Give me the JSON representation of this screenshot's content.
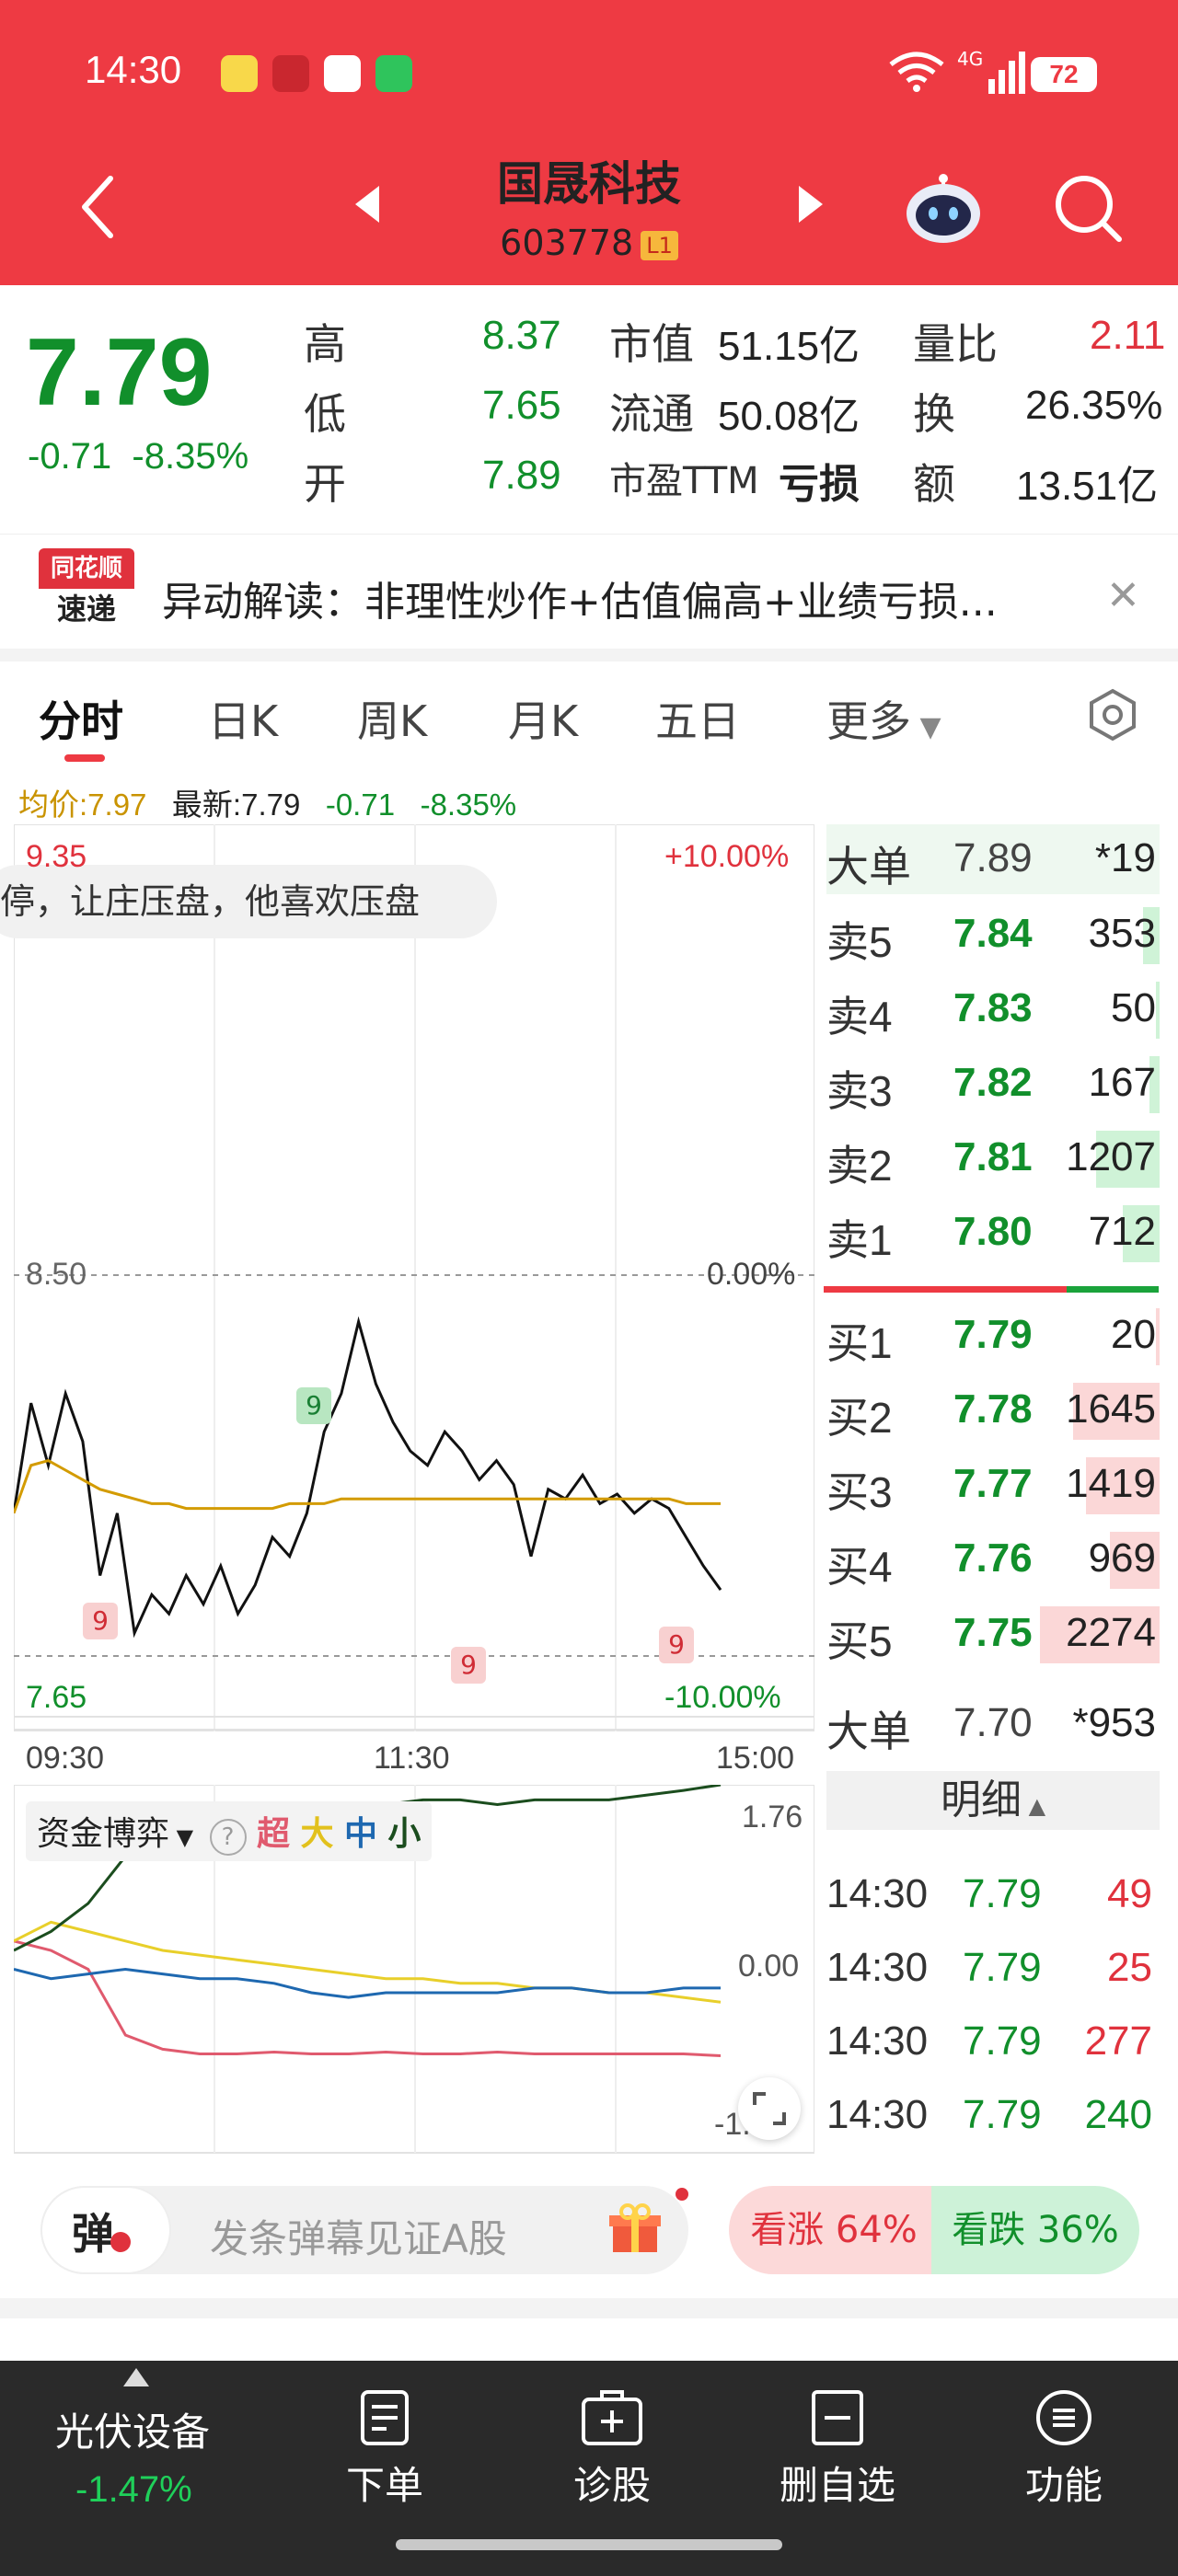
{
  "status_bar": {
    "time": "14:30",
    "network": "4G",
    "battery": "72"
  },
  "header": {
    "stock_name": "国晟科技",
    "stock_code": "603778",
    "level": "L1"
  },
  "quote": {
    "price": "7.79",
    "change": "-0.71",
    "change_pct": "-8.35%",
    "high_label": "高",
    "high": "8.37",
    "low_label": "低",
    "low": "7.65",
    "open_label": "开",
    "open": "7.89",
    "mktcap_label": "市值",
    "mktcap": "51.15亿",
    "float_label": "流通",
    "float": "50.08亿",
    "pe_label": "市盈TTM",
    "pe": "亏损",
    "volratio_label": "量比",
    "volratio": "2.11",
    "turnover_label": "换",
    "turnover": "26.35%",
    "amount_label": "额",
    "amount": "13.51亿"
  },
  "alert": {
    "logo_line1": "同花顺",
    "logo_line2": "速递",
    "text": "异动解读：非理性炒作+估值偏高+业绩亏损..."
  },
  "tabs": [
    "分时",
    "日K",
    "周K",
    "月K",
    "五日",
    "更多"
  ],
  "chart_header": {
    "avg": "均价:7.97",
    "latest": "最新:7.79",
    "chg": "-0.71",
    "pct": "-8.35%"
  },
  "chart_labels": {
    "top_price": "9.35",
    "top_pct": "+10.00%",
    "mid_price": "8.50",
    "mid_pct": "0.00%",
    "bot_price": "7.65",
    "bot_pct": "-10.00%",
    "t_start": "09:30",
    "t_mid": "11:30",
    "t_end": "15:00",
    "bubble": "停，让庄压盘，他喜欢压盘",
    "marker": "9"
  },
  "chart_data": [
    {
      "type": "line",
      "title": "",
      "x_range": [
        "09:30",
        "15:00"
      ],
      "ylim": [
        7.65,
        9.35
      ],
      "prev_close": 8.5,
      "series": [
        {
          "name": "最新",
          "values": [
            7.95,
            8.18,
            8.05,
            8.2,
            8.1,
            7.82,
            7.95,
            7.7,
            7.78,
            7.74,
            7.82,
            7.76,
            7.84,
            7.74,
            7.8,
            7.9,
            7.86,
            7.95,
            8.12,
            8.2,
            8.35,
            8.22,
            8.14,
            8.08,
            8.05,
            8.12,
            8.08,
            8.02,
            8.06,
            8.01,
            7.86,
            8.0,
            7.98,
            8.03,
            7.97,
            7.99,
            7.95,
            7.98,
            7.96,
            7.9,
            7.84,
            7.79
          ]
        },
        {
          "name": "均价",
          "values": [
            7.95,
            8.05,
            8.06,
            8.04,
            8.02,
            8.0,
            7.99,
            7.98,
            7.97,
            7.97,
            7.96,
            7.96,
            7.96,
            7.96,
            7.96,
            7.96,
            7.97,
            7.97,
            7.97,
            7.98,
            7.98,
            7.98,
            7.98,
            7.98,
            7.98,
            7.98,
            7.98,
            7.98,
            7.98,
            7.98,
            7.98,
            7.98,
            7.98,
            7.98,
            7.98,
            7.98,
            7.98,
            7.98,
            7.98,
            7.97,
            7.97,
            7.97
          ]
        }
      ]
    },
    {
      "type": "line",
      "title": "资金博弈",
      "ylim": [
        -1.76,
        1.76
      ],
      "series": [
        {
          "name": "超",
          "values": [
            0.1,
            0.0,
            -0.2,
            -0.9,
            -1.05,
            -1.1,
            -1.1,
            -1.08,
            -1.1,
            -1.1,
            -1.08,
            -1.1,
            -1.1,
            -1.08,
            -1.1,
            -1.1,
            -1.1,
            -1.1,
            -1.1,
            -1.12
          ]
        },
        {
          "name": "大",
          "values": [
            0.1,
            0.3,
            0.2,
            0.1,
            0.0,
            -0.05,
            -0.1,
            -0.15,
            -0.2,
            -0.25,
            -0.3,
            -0.3,
            -0.35,
            -0.35,
            -0.4,
            -0.4,
            -0.45,
            -0.45,
            -0.5,
            -0.55
          ]
        },
        {
          "name": "中",
          "values": [
            -0.2,
            -0.3,
            -0.25,
            -0.2,
            -0.25,
            -0.3,
            -0.3,
            -0.35,
            -0.45,
            -0.5,
            -0.45,
            -0.45,
            -0.45,
            -0.45,
            -0.4,
            -0.4,
            -0.45,
            -0.45,
            -0.4,
            -0.4
          ]
        },
        {
          "name": "小",
          "values": [
            0.0,
            0.2,
            0.5,
            1.0,
            1.3,
            1.45,
            1.5,
            1.55,
            1.55,
            1.55,
            1.55,
            1.6,
            1.6,
            1.55,
            1.6,
            1.6,
            1.6,
            1.65,
            1.7,
            1.76
          ]
        }
      ]
    }
  ],
  "order_book": {
    "big_top": {
      "label": "大单",
      "price": "7.89",
      "vol": "*19"
    },
    "asks": [
      {
        "label": "卖5",
        "price": "7.84",
        "vol": "353",
        "bar": 0.05
      },
      {
        "label": "卖4",
        "price": "7.83",
        "vol": "50",
        "bar": 0.01
      },
      {
        "label": "卖3",
        "price": "7.82",
        "vol": "167",
        "bar": 0.03
      },
      {
        "label": "卖2",
        "price": "7.81",
        "vol": "1207",
        "bar": 0.19
      },
      {
        "label": "卖1",
        "price": "7.80",
        "vol": "712",
        "bar": 0.11
      }
    ],
    "bids": [
      {
        "label": "买1",
        "price": "7.79",
        "vol": "20",
        "bar": 0.01
      },
      {
        "label": "买2",
        "price": "7.78",
        "vol": "1645",
        "bar": 0.26
      },
      {
        "label": "买3",
        "price": "7.77",
        "vol": "1419",
        "bar": 0.22
      },
      {
        "label": "买4",
        "price": "7.76",
        "vol": "969",
        "bar": 0.15
      },
      {
        "label": "买5",
        "price": "7.75",
        "vol": "2274",
        "bar": 0.36
      }
    ],
    "big_bottom": {
      "label": "大单",
      "price": "7.70",
      "vol": "*953"
    }
  },
  "detail": {
    "header": "明细",
    "rows": [
      {
        "time": "14:30",
        "price": "7.79",
        "vol": "49",
        "side": "buy"
      },
      {
        "time": "14:30",
        "price": "7.79",
        "vol": "25",
        "side": "buy"
      },
      {
        "time": "14:30",
        "price": "7.79",
        "vol": "277",
        "side": "buy"
      },
      {
        "time": "14:30",
        "price": "7.79",
        "vol": "240",
        "side": "sell"
      }
    ]
  },
  "fund": {
    "title": "资金博弈",
    "help": "?",
    "super": "超",
    "big": "大",
    "mid": "中",
    "small": "小",
    "top": "1.76",
    "zero": "0.00",
    "bottom": "-1.76"
  },
  "barrage": {
    "btn": "弹",
    "placeholder": "发条弹幕见证A股",
    "up": "看涨 64%",
    "down": "看跌 36%",
    "up_pct": 64
  },
  "bottom_nav": {
    "sector_name": "光伏设备",
    "sector_chg": "-1.47%",
    "items": [
      "下单",
      "诊股",
      "删自选",
      "功能"
    ]
  },
  "colors": {
    "accent": "#ee3a43",
    "up": "#e0323d",
    "down": "#118f2b"
  }
}
